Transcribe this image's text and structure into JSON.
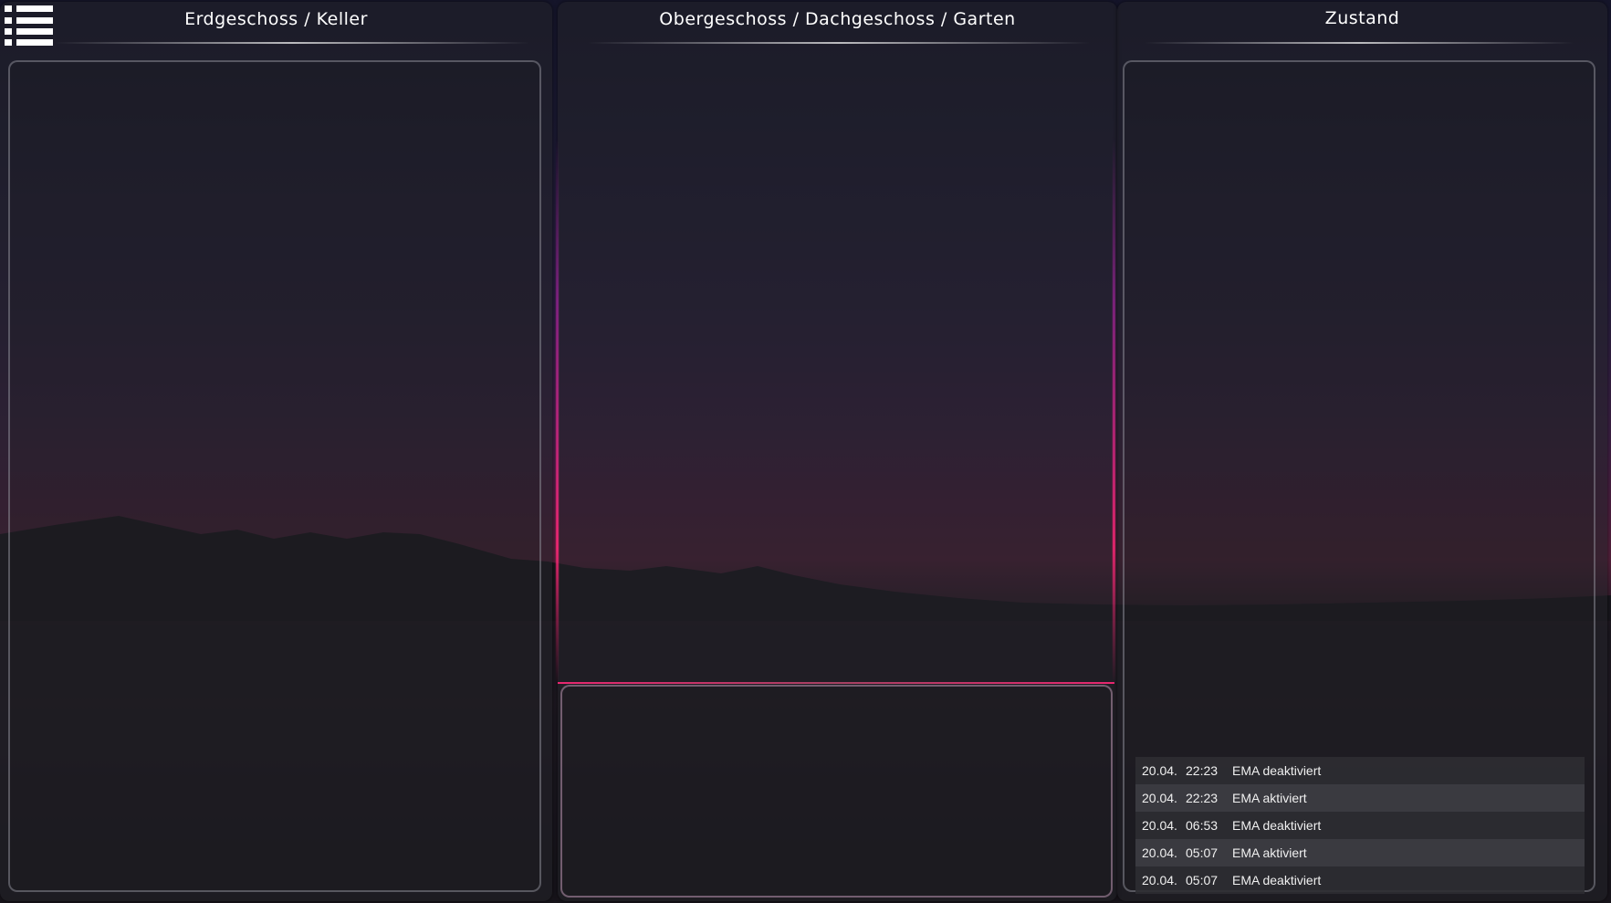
{
  "menu": {
    "icon": "menu-list-icon"
  },
  "panels": {
    "left": {
      "title": "Erdgeschoss / Keller"
    },
    "middle": {
      "title": "Obergeschoss / Dachgeschoss / Garten"
    },
    "right": {
      "title": "Zustand"
    }
  },
  "log": {
    "entries": [
      {
        "date": "20.04.",
        "time": "22:23",
        "message": "EMA deaktiviert"
      },
      {
        "date": "20.04.",
        "time": "22:23",
        "message": "EMA aktiviert"
      },
      {
        "date": "20.04.",
        "time": "06:53",
        "message": "EMA deaktiviert"
      },
      {
        "date": "20.04.",
        "time": "05:07",
        "message": "EMA aktiviert"
      },
      {
        "date": "20.04.",
        "time": "05:07",
        "message": "EMA deaktiviert"
      }
    ]
  },
  "colors": {
    "accent_glow": "#ff2878",
    "text": "#ffffff"
  }
}
